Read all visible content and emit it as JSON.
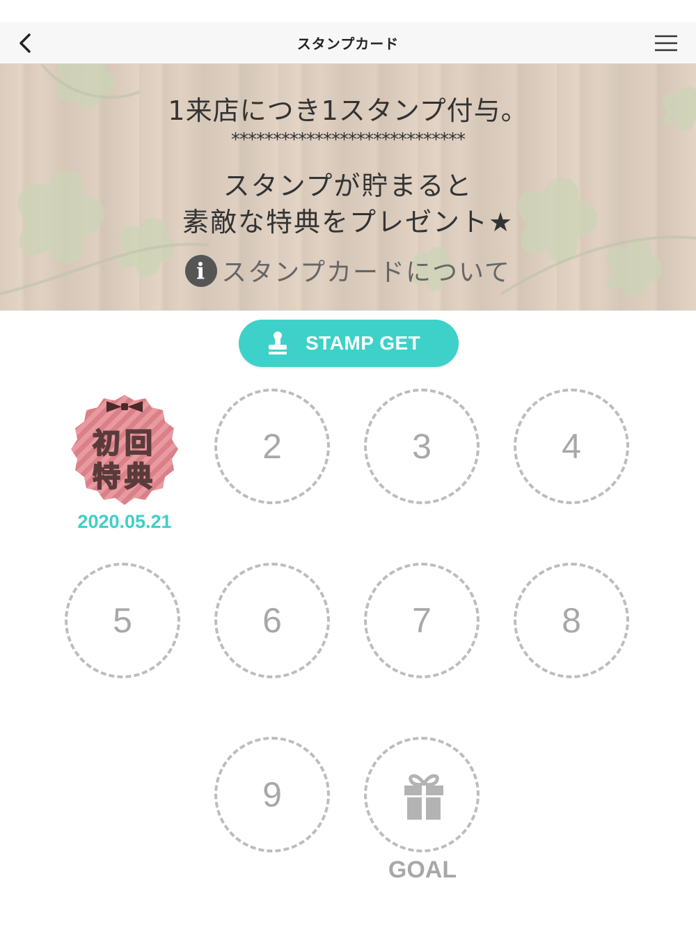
{
  "nav": {
    "title": "スタンプカード",
    "back_icon": "chevron-left-icon",
    "menu_icon": "hamburger-menu-icon"
  },
  "hero": {
    "line1": "1来店につき1スタンプ付与。",
    "stars": "****************************",
    "line2": "スタンプが貯まると",
    "line3": "素敵な特典をプレゼント★",
    "about_link": "スタンプカードについて",
    "about_icon": "info-icon"
  },
  "stamp_get": {
    "label": "STAMP GET",
    "icon": "stamp-icon",
    "color": "#3ed1c9"
  },
  "card": {
    "first_stamp": {
      "line1": "初回",
      "line2": "特典",
      "date": "2020.05.21",
      "badge_color": "#e8939a",
      "date_color": "#3ecfc7"
    },
    "slots": [
      "2",
      "3",
      "4",
      "5",
      "6",
      "7",
      "8",
      "9"
    ],
    "goal": {
      "label": "GOAL",
      "icon": "gift-icon"
    }
  }
}
